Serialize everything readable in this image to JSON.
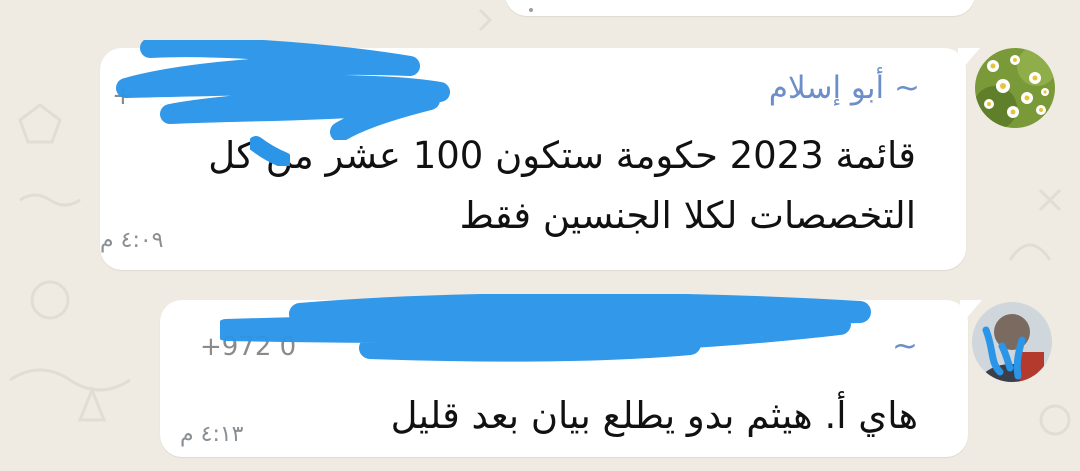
{
  "chat": {
    "messages": [
      {
        "sender_name": "~ أبو إسلام",
        "phone": "+",
        "text_line1": "قائمة 2023 حكومة ستكون 100 عشر من كل",
        "text_line2": "التخصصات لكلا الجنسين فقط",
        "time": "٤:٠٩ م",
        "avatar_icon": "daisy-flowers-avatar"
      },
      {
        "sender_name": "~",
        "phone": "+972 0",
        "text": "هاي أ. هيثم بدو يطلع بيان بعد قليل",
        "time": "٤:١٣ م",
        "avatar_icon": "person-photo-avatar"
      }
    ]
  },
  "colors": {
    "chat_background": "#efeae2",
    "bubble": "#ffffff",
    "sender_name": "#6d8fc9",
    "redaction_scribble": "#2b95e8",
    "timestamp": "#8a8f93"
  }
}
